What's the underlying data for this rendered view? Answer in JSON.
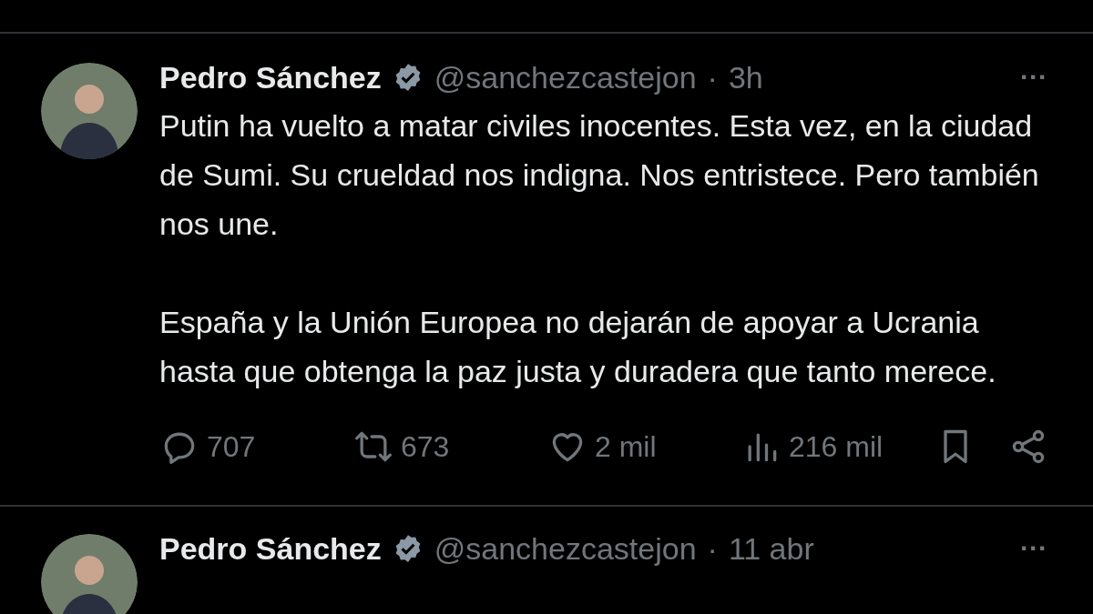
{
  "tweets": [
    {
      "name": "Pedro Sánchez",
      "verified": true,
      "handle": "@sanchezcastejon",
      "separator": "·",
      "time": "3h",
      "more": "···",
      "paragraphs": [
        "Putin ha vuelto a matar civiles inocentes. Esta vez, en la ciudad de Sumi. Su crueldad nos indigna. Nos entristece. Pero también nos une.",
        "España y la Unión Europea no dejarán de apoyar a Ucrania hasta que obtenga la paz justa y duradera que tanto merece."
      ],
      "actions": [
        {
          "kind": "reply",
          "count": "707"
        },
        {
          "kind": "repost",
          "count": "673"
        },
        {
          "kind": "like",
          "count": "2 mil"
        },
        {
          "kind": "views",
          "count": "216 mil"
        },
        {
          "kind": "bookmark"
        },
        {
          "kind": "share"
        }
      ]
    },
    {
      "name": "Pedro Sánchez",
      "verified": true,
      "handle": "@sanchezcastejon",
      "separator": "·",
      "time": "11 abr",
      "more": "···"
    }
  ]
}
